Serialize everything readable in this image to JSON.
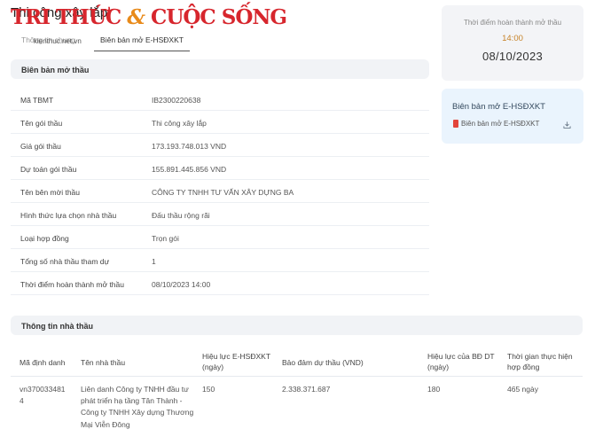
{
  "header": {
    "page_title": "Thi công xây lắp",
    "logo_red": "TRI THỨC",
    "logo_amp": "&",
    "logo_orange": "CUỘC SỐNG",
    "logo_url": "kienthuc.net.vn",
    "tab_left": "Thông tin chung",
    "tab_active": "Biên bản mở E-HSĐXKT"
  },
  "bid_record": {
    "section_title": "Biên bản mở thầu",
    "rows": [
      {
        "label": "Mã TBMT",
        "value": "IB2300220638"
      },
      {
        "label": "Tên gói thầu",
        "value": "Thi công xây lắp"
      },
      {
        "label": "Giá gói thầu",
        "value": "173.193.748.013 VND"
      },
      {
        "label": "Dự toán gói thầu",
        "value": "155.891.445.856 VND"
      },
      {
        "label": "Tên bên mời thầu",
        "value": "CÔNG TY TNHH TƯ VẤN XÂY DỰNG BA"
      },
      {
        "label": "Hình thức lựa chọn nhà thầu",
        "value": "Đấu thầu rộng rãi"
      },
      {
        "label": "Loại hợp đồng",
        "value": "Trọn gói"
      },
      {
        "label": "Tổng số nhà thầu tham dự",
        "value": "1"
      },
      {
        "label": "Thời điểm hoàn thành mở thầu",
        "value": "08/10/2023 14:00"
      }
    ]
  },
  "completion": {
    "label": "Thời điểm hoàn thành mở thầu",
    "time": "14:00",
    "date": "08/10/2023"
  },
  "document": {
    "title": "Biên bản mở E-HSĐXKT",
    "file_label": "Biên bản mở E-HSĐXKT",
    "file_icon": "pdf-icon",
    "action_icon": "download-icon"
  },
  "bidders": {
    "section_title": "Thông tin nhà thầu",
    "columns": {
      "id": "Mã định danh",
      "name": "Tên nhà thầu",
      "validity_1": "Hiệu lực E-HSĐXKT",
      "validity_2": "(ngày)",
      "guarantee": "Bảo đảm dự thầu (VND)",
      "bd_1": "Hiệu lực của BĐ DT",
      "bd_2": "(ngày)",
      "time_1": "Thời gian thực hiện",
      "time_2": "hợp đồng"
    },
    "rows": [
      {
        "id_1": "vn370033481",
        "id_2": "4",
        "name_1": "Liên danh Công ty TNHH đầu tư",
        "name_2": "phát triển hạ tầng Tân Thành -",
        "name_3": "Công ty TNHH Xây dựng Thương",
        "name_4": "Mại Viễn Đông",
        "validity": "150",
        "guarantee": "2.338.371.687",
        "bd_validity": "180",
        "duration": "465 ngày"
      }
    ]
  },
  "colors": {
    "accent_time": "#c7832a",
    "doc_panel": "#eaf4fd",
    "logo_red": "#d7262d",
    "logo_orange": "#e88a1a"
  }
}
